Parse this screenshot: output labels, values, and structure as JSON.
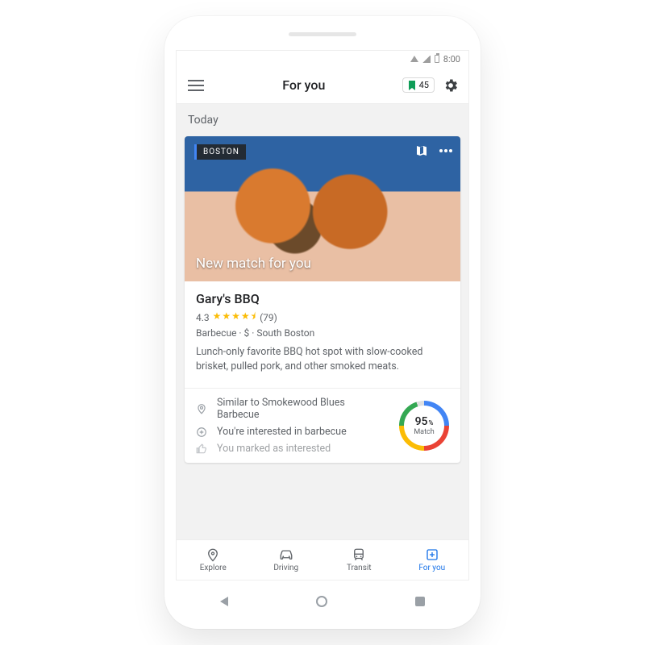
{
  "status": {
    "time": "8:00"
  },
  "header": {
    "title": "For you",
    "bookmark_count": "45"
  },
  "section_label": "Today",
  "card": {
    "location_chip": "BOSTON",
    "hero_caption": "New match for you",
    "place_name": "Gary's BBQ",
    "rating_value": "4.3",
    "stars": "★★★★⯨",
    "review_count": "(79)",
    "category": "Barbecue",
    "price": "$",
    "neighborhood": "South Boston",
    "description": "Lunch-only favorite BBQ hot spot with slow-cooked brisket, pulled pork, and other smoked meats.",
    "reasons": {
      "0": "Similar to Smokewood Blues Barbecue",
      "1": "You're interested in barbecue",
      "2": "You marked as interested"
    },
    "match": {
      "percent": "95",
      "label": "Match"
    }
  },
  "tabs": {
    "explore": "Explore",
    "driving": "Driving",
    "transit": "Transit",
    "foryou": "For you"
  }
}
